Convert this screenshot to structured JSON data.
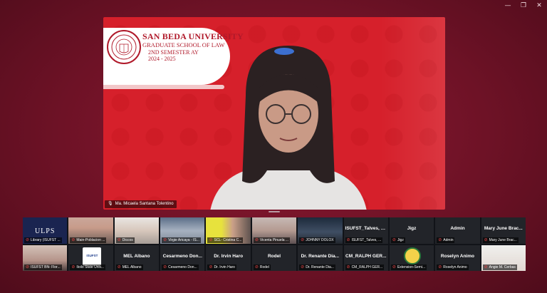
{
  "window": {
    "controls": {
      "minimize": "—",
      "restore": "❐",
      "close": "✕"
    }
  },
  "main_video": {
    "banner": {
      "line1": "SAN BEDA UNIVERSITY",
      "line2": "GRADUATE SCHOOL OF LAW",
      "line3": "2ND SEMESTER AY",
      "line4": "2024 - 2025"
    },
    "speaker_name": "Ma. Micaela Santana Tolentino",
    "background_color": "#d6202b"
  },
  "gallery": {
    "row1": [
      {
        "name": "Library (ISUFST ...",
        "kind": "logo-ulps",
        "logo_text": "ULPS"
      },
      {
        "name": "Main-Poblacion ...",
        "kind": "face-a"
      },
      {
        "name": "Diccos",
        "kind": "face-b"
      },
      {
        "name": "Virgie Aricaya - IS...",
        "kind": "face-c"
      },
      {
        "name": "SCL- Cristina C...",
        "kind": "face-d"
      },
      {
        "name": "Vicenta Pinuela ...",
        "kind": "face-e"
      },
      {
        "name": "JOHNNY DOLOX",
        "kind": "face-f"
      },
      {
        "name": "ISUFST_Talves, ...",
        "kind": "text",
        "center": "ISUFST_Talves, S..."
      },
      {
        "name": "Jigz",
        "kind": "text",
        "center": "Jigz"
      },
      {
        "name": "Admin",
        "kind": "text",
        "center": "Admin"
      },
      {
        "name": "Mary June Brac...",
        "kind": "text",
        "center": "Mary June Brac..."
      }
    ],
    "row2": [
      {
        "name": "ISUFST BN- Flor...",
        "kind": "face-g"
      },
      {
        "name": "Iloilo State Univ...",
        "kind": "logo-isufst",
        "logo_text": "ISUFST"
      },
      {
        "name": "MEL Albano",
        "kind": "text",
        "center": "MEL Albano"
      },
      {
        "name": "Cesarmeno Don...",
        "kind": "text",
        "center": "Cesarmeno Don..."
      },
      {
        "name": "Dr. Irvin Haro",
        "kind": "text",
        "center": "Dr. Irvin Haro"
      },
      {
        "name": "Rodel",
        "kind": "text",
        "center": "Rodel"
      },
      {
        "name": "Dr. Renante Dia...",
        "kind": "text",
        "center": "Dr. Renante Dia..."
      },
      {
        "name": "CM_RALPH GER...",
        "kind": "text",
        "center": "CM_RALPH GER..."
      },
      {
        "name": "Extension-Semi...",
        "kind": "logo-ext"
      },
      {
        "name": "Roselyn Animo",
        "kind": "text",
        "center": "Roselyn Animo"
      },
      {
        "name": "Angie M. Cerbas",
        "kind": "face-h"
      }
    ]
  }
}
